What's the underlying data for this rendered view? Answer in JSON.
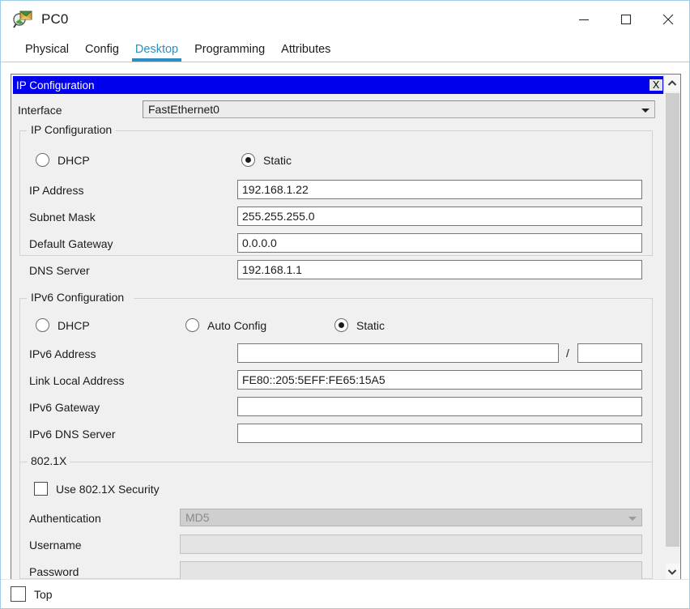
{
  "window": {
    "title": "PC0",
    "icon": "pc-magnifier-icon",
    "minimize_label": "—",
    "maximize_label": "□",
    "close_label": "✕"
  },
  "tabs": [
    {
      "label": "Physical",
      "active": false
    },
    {
      "label": "Config",
      "active": false
    },
    {
      "label": "Desktop",
      "active": true
    },
    {
      "label": "Programming",
      "active": false
    },
    {
      "label": "Attributes",
      "active": false
    }
  ],
  "inner_window": {
    "caption": "IP Configuration",
    "close_label": "X",
    "caption_bg": "#0000ee",
    "caption_fg": "#ffffff"
  },
  "interface": {
    "label": "Interface",
    "value": "FastEthernet0"
  },
  "ip_configuration": {
    "group_title": "IP Configuration",
    "mode_dhcp": "DHCP",
    "mode_static": "Static",
    "selected_mode": "Static",
    "fields": [
      {
        "label": "IP Address",
        "value": "192.168.1.22"
      },
      {
        "label": "Subnet Mask",
        "value": "255.255.255.0"
      },
      {
        "label": "Default Gateway",
        "value": "0.0.0.0"
      },
      {
        "label": "DNS Server",
        "value": "192.168.1.1"
      }
    ]
  },
  "ipv6_configuration": {
    "group_title": "IPv6 Configuration",
    "mode_dhcp": "DHCP",
    "mode_auto": "Auto Config",
    "mode_static": "Static",
    "selected_mode": "Static",
    "address_label": "IPv6 Address",
    "address_value": "",
    "prefix_separator": "/",
    "prefix_value": "",
    "fields": [
      {
        "label": "Link Local Address",
        "value": "FE80::205:5EFF:FE65:15A5"
      },
      {
        "label": "IPv6 Gateway",
        "value": ""
      },
      {
        "label": "IPv6 DNS Server",
        "value": ""
      }
    ]
  },
  "dot1x": {
    "group_title": "802.1X",
    "use_security_label": "Use 802.1X Security",
    "use_security_checked": false,
    "authentication_label": "Authentication",
    "authentication_value": "MD5",
    "username_label": "Username",
    "username_value": "",
    "password_label": "Password",
    "password_value": ""
  },
  "bottom": {
    "top_label": "Top",
    "top_checked": false
  },
  "colors": {
    "accent": "#2b8fc4",
    "caption_blue": "#0000ee",
    "panel_bg": "#f0f0f0"
  }
}
